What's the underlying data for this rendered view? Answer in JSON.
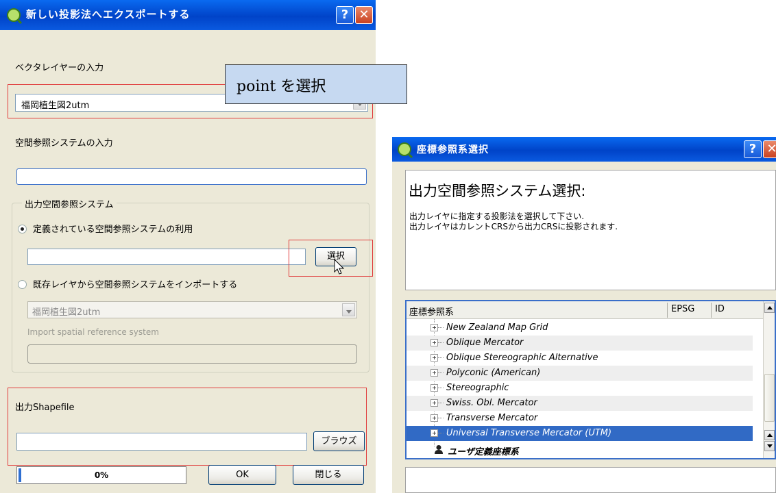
{
  "left_dialog": {
    "title": "新しい投影法へエクスポートする",
    "help_label": "?",
    "close_label": "✕",
    "vector_layer_label": "ベクタレイヤーの入力",
    "vector_layer_value": "福岡植生図2utm",
    "input_crs_label": "空間参照システムの入力",
    "input_crs_value": "",
    "output_group_label": "出力空間参照システム",
    "radio_defined_label": "定義されている空間参照システムの利用",
    "defined_crs_value": "",
    "select_button": "選択",
    "radio_import_label": "既存レイヤから空間参照システムをインポートする",
    "import_layer_value": "福岡植生図2utm",
    "import_crs_label": "Import spatial reference system",
    "import_crs_value": "",
    "output_shapefile_label": "出力Shapefile",
    "output_shapefile_value": "",
    "browse_button": "ブラウズ",
    "progress_text": "0%",
    "progress_value": 0,
    "ok_button": "OK",
    "close_button": "閉じる"
  },
  "callout": {
    "text": "point を選択"
  },
  "right_dialog": {
    "title": "座標参照系選択",
    "help_label": "?",
    "close_label": "✕",
    "heading": "出力空間参照システム選択:",
    "desc_line1": "出力レイヤに指定する投影法を選択して下さい.",
    "desc_line2": "出力レイヤはカレントCRSから出力CRSに投影されます.",
    "columns": [
      "座標参照系",
      "EPSG",
      "ID"
    ],
    "tree_items": [
      "New Zealand Map Grid",
      "Oblique Mercator",
      "Oblique Stereographic Alternative",
      "Polyconic (American)",
      "Stereographic",
      "Swiss. Obl. Mercator",
      "Transverse Mercator",
      "Universal Transverse Mercator (UTM)"
    ],
    "user_defined_label": "ユーザ定義座標系"
  }
}
